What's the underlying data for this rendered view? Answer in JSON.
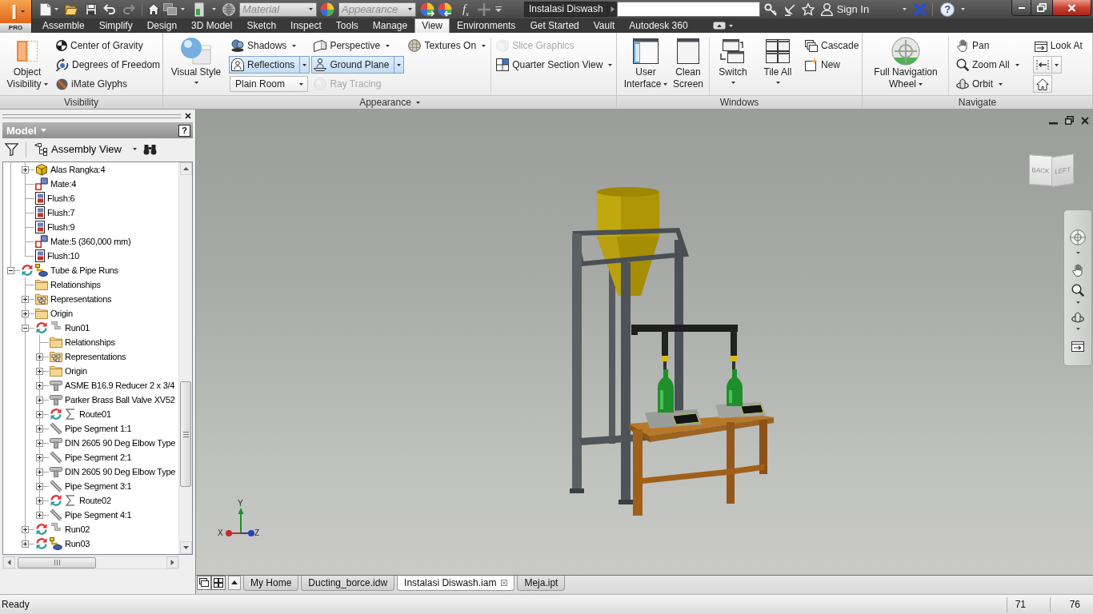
{
  "title_bar": {
    "app_button": {
      "logo": "I",
      "edition": "PRO"
    },
    "material": {
      "placeholder": "Material"
    },
    "appearance": {
      "placeholder": "Appearance"
    },
    "parameters": "f$_{x}$",
    "document_title": "Instalasi Diswash",
    "sign_in": "Sign In",
    "help": "?"
  },
  "ribbon_tabs": [
    {
      "label": "Assemble",
      "selected": false
    },
    {
      "label": "Simplify",
      "selected": false
    },
    {
      "label": "Design",
      "selected": false
    },
    {
      "label": "3D Model",
      "selected": false
    },
    {
      "label": "Sketch",
      "selected": false
    },
    {
      "label": "Inspect",
      "selected": false
    },
    {
      "label": "Tools",
      "selected": false
    },
    {
      "label": "Manage",
      "selected": false
    },
    {
      "label": "View",
      "selected": true
    },
    {
      "label": "Environments",
      "selected": false
    },
    {
      "label": "Get Started",
      "selected": false
    },
    {
      "label": "Vault",
      "selected": false
    },
    {
      "label": "Autodesk 360",
      "selected": false
    }
  ],
  "ribbon_panels": [
    {
      "title": "Visibility",
      "menu": false,
      "groups": [
        {
          "kind": "large",
          "label": "Object Visibility",
          "menu": true
        },
        {
          "kind": "column",
          "items": [
            {
              "kind": "button",
              "label": "Center of Gravity",
              "menu": false
            },
            {
              "kind": "button",
              "label": "Degrees of Freedom",
              "menu": false
            },
            {
              "kind": "button",
              "label": "iMate Glyphs",
              "menu": false
            }
          ]
        }
      ]
    },
    {
      "title": "Appearance",
      "menu": true,
      "groups": [
        {
          "kind": "split",
          "label": "Visual Style",
          "menu": true
        },
        {
          "kind": "column",
          "items": [
            {
              "kind": "toggle",
              "label": "Shadows",
              "on": false,
              "menu": true
            },
            {
              "kind": "toggle",
              "label": "Reflections",
              "on": true,
              "menu": true
            },
            {
              "kind": "combo",
              "value": "Plain Room"
            }
          ]
        },
        {
          "kind": "column",
          "items": [
            {
              "kind": "toggle",
              "label": "Perspective",
              "on": false,
              "menu": true,
              "disabled": false
            },
            {
              "kind": "toggle",
              "label": "Ground Plane",
              "on": true,
              "menu": true,
              "disabled": false
            },
            {
              "kind": "button",
              "label": "Ray Tracing",
              "menu": false,
              "disabled": true
            }
          ]
        },
        {
          "kind": "column",
          "items": [
            {
              "kind": "button",
              "label": "Textures On",
              "menu": true
            }
          ]
        },
        {
          "kind": "separator"
        },
        {
          "kind": "column",
          "items": [
            {
              "kind": "button",
              "label": "Slice Graphics",
              "menu": false,
              "disabled": true
            },
            {
              "kind": "button",
              "label": "Quarter Section View",
              "menu": true,
              "disabled": false
            }
          ]
        }
      ]
    },
    {
      "title": "Windows",
      "menu": false,
      "groups": [
        {
          "kind": "large",
          "label": "User Interface",
          "menu": true
        },
        {
          "kind": "large",
          "label": "Clean Screen",
          "menu": false
        },
        {
          "kind": "separator"
        },
        {
          "kind": "split",
          "label": "Switch",
          "menu": true
        },
        {
          "kind": "split",
          "label": "Tile All",
          "menu": true
        },
        {
          "kind": "column",
          "items": [
            {
              "kind": "button",
              "label": "Cascade",
              "menu": false
            },
            {
              "kind": "button",
              "label": "New",
              "menu": false
            }
          ]
        }
      ]
    },
    {
      "title": "Navigate",
      "menu": false,
      "groups": [
        {
          "kind": "large",
          "label": "Full Navigation Wheel",
          "menu": true
        },
        {
          "kind": "separator"
        },
        {
          "kind": "column",
          "items": [
            {
              "kind": "button",
              "label": "Pan",
              "menu": false
            },
            {
              "kind": "button",
              "label": "Zoom All",
              "menu": true
            },
            {
              "kind": "button",
              "label": "Orbit",
              "menu": true
            }
          ]
        },
        {
          "kind": "column",
          "items": [
            {
              "kind": "button",
              "label": "Look At",
              "menu": false
            },
            {
              "kind": "icon",
              "menu": true
            },
            {
              "kind": "icon",
              "menu": false
            }
          ]
        }
      ]
    }
  ],
  "browser": {
    "title": "Model",
    "help": "?",
    "view": "Assembly View",
    "tree": [
      {
        "children": [
          {
            "kind": "part",
            "label": "Alas Rangka:4",
            "expanded": false
          },
          {
            "kind": "mate",
            "label": "Mate:4"
          },
          {
            "kind": "flush",
            "label": "Flush:6"
          },
          {
            "kind": "flush",
            "label": "Flush:7"
          },
          {
            "kind": "flush",
            "label": "Flush:9"
          },
          {
            "kind": "mate",
            "label": "Mate:5 (360,000 mm)"
          },
          {
            "kind": "flush",
            "label": "Flush:10"
          }
        ]
      },
      {
        "kind": "runs",
        "label": "Tube & Pipe Runs",
        "expanded": true,
        "children": [
          {
            "kind": "folder",
            "label": "Relationships"
          },
          {
            "kind": "representations",
            "label": "Representations",
            "expanded": false
          },
          {
            "kind": "folder",
            "label": "Origin",
            "expanded": false
          },
          {
            "kind": "run",
            "label": "Run01",
            "expanded": true,
            "children": [
              {
                "kind": "folder",
                "label": "Relationships"
              },
              {
                "kind": "representations",
                "label": "Representations",
                "expanded": false
              },
              {
                "kind": "folder",
                "label": "Origin",
                "expanded": false
              },
              {
                "kind": "fitting",
                "label": "ASME B16.9 Reducer 2 x 3/4",
                "expanded": false
              },
              {
                "kind": "fitting",
                "label": "Parker Brass Ball Valve XV52",
                "expanded": false
              },
              {
                "kind": "route",
                "label": "Route01",
                "expanded": false
              },
              {
                "kind": "pipe",
                "label": "Pipe Segment 1:1",
                "expanded": false
              },
              {
                "kind": "fitting",
                "label": "DIN 2605 90 Deg Elbow Type",
                "expanded": false
              },
              {
                "kind": "pipe",
                "label": "Pipe Segment 2:1",
                "expanded": false
              },
              {
                "kind": "fitting",
                "label": "DIN 2605 90 Deg Elbow Type",
                "expanded": false
              },
              {
                "kind": "pipe",
                "label": "Pipe Segment 3:1",
                "expanded": false
              },
              {
                "kind": "route",
                "label": "Route02",
                "expanded": false
              },
              {
                "kind": "pipe",
                "label": "Pipe Segment 4:1",
                "expanded": false
              }
            ]
          },
          {
            "kind": "run",
            "label": "Run02",
            "expanded": false
          },
          {
            "kind": "activerun",
            "label": "Run03",
            "expanded": false
          }
        ]
      }
    ]
  },
  "viewport": {
    "view_cube": {
      "faces": [
        "BACK",
        "LEFT"
      ]
    },
    "axis_triad": {
      "labels": [
        "X",
        "Y",
        "Z"
      ]
    }
  },
  "document_tabs": [
    {
      "label": "My Home",
      "selected": false
    },
    {
      "label": "Ducting_borce.idw",
      "selected": false
    },
    {
      "label": "Instalasi Diswash.iam",
      "selected": true
    },
    {
      "label": "Meja.ipt",
      "selected": false
    }
  ],
  "status_bar": {
    "message": "Ready",
    "readings": [
      "71",
      "76"
    ]
  }
}
